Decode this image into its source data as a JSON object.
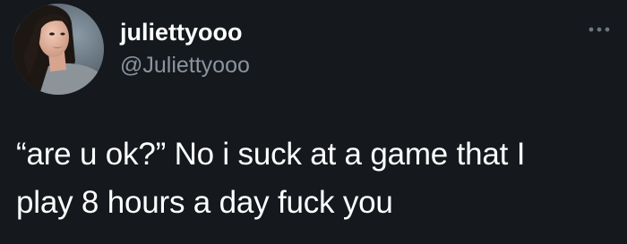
{
  "user": {
    "display_name": "juliettyooo",
    "handle": "@Juliettyooo"
  },
  "tweet": {
    "lines": [
      "“are u ok?” No i suck at a game that I",
      "play 8 hours a day fuck you"
    ]
  },
  "icons": {
    "avatar": "profile-photo",
    "more": "more-options-icon"
  },
  "colors": {
    "background": "#15181d",
    "primary_text": "#ffffff",
    "secondary_text": "#8b949e"
  }
}
